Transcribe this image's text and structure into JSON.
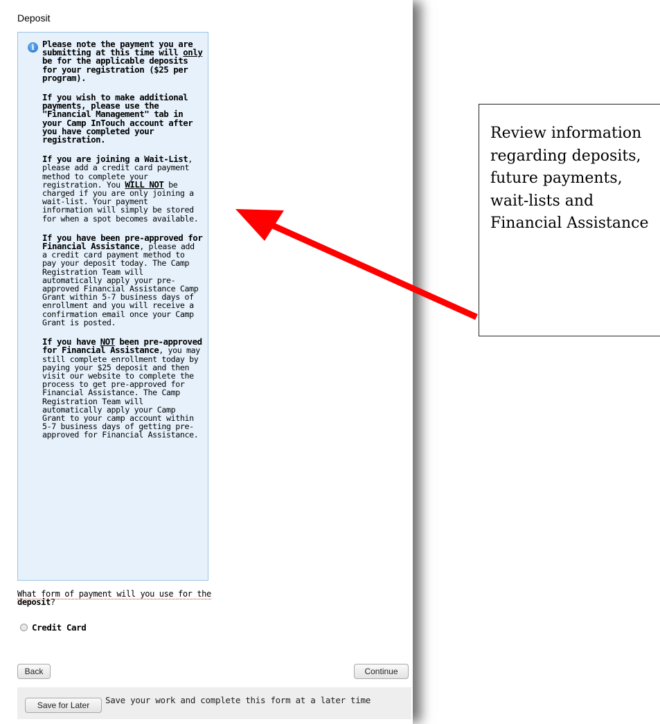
{
  "form": {
    "title": "Deposit",
    "info": {
      "p1": "Please note the payment you are submitting at this time will",
      "p1_u": "only",
      "p1_rest": "be for the applicable deposits for your registration ($25 per program).",
      "p2": "If you wish to make additional payments, please use the \"Financial Management\" tab in your Camp InTouch account after you have completed your registration.",
      "p3_b": "If you are joining a Wait-List",
      "p3": ", please add a credit card payment method to complete your registration. You",
      "p3_u": "WILL NOT",
      "p3_rest": "be charged if you are only joining a wait-list. Your payment information will simply be stored for when a spot becomes available.",
      "p4_b": "If you have been pre-approved for Financial Assistance",
      "p4": ", please add a credit card payment method to pay your deposit today. The Camp Registration Team will automatically apply your pre-approved Financial Assistance Camp Grant within 5-7 business days of enrollment and you will receive a confirmation email once your Camp Grant is posted.",
      "p5_b1": "If you have",
      "p5_u": "NOT",
      "p5_b2": "been pre-approved for Financial Assistance",
      "p5": ", you may still complete enrollment today by paying your $25 deposit and then visit our website to complete the process to get pre-approved for Financial Assistance. The Camp Registration Team will automatically apply your Camp Grant to your camp account within 5-7 business days of getting pre-approved for Financial Assistance."
    },
    "question_a": "What form of payment will you use for the ",
    "question_b": "deposit",
    "question_c": "?",
    "option_credit_card": "Credit Card",
    "back_label": "Back",
    "continue_label": "Continue",
    "save_label": "Save for Later",
    "save_text": "Save your work and complete this form at a later time"
  },
  "annotation": {
    "text": "Review information regarding deposits, future payments, wait-lists and Financial Assistance",
    "arrow_color": "#ff0000"
  }
}
